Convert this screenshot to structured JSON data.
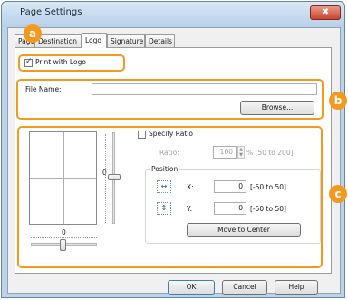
{
  "window": {
    "title": "Page Settings",
    "close_label": "✖"
  },
  "tabs": [
    {
      "label": "Page Setup",
      "active": false
    },
    {
      "label": "Destination",
      "active": false
    },
    {
      "label": "Logo",
      "active": true
    },
    {
      "label": "Signature",
      "active": false
    },
    {
      "label": "Details",
      "active": false
    }
  ],
  "callouts": {
    "a": "a",
    "b": "b",
    "c": "c"
  },
  "logo": {
    "print_with_logo_label": "Print with Logo",
    "print_with_logo_checked": true
  },
  "file": {
    "name_label": "File Name:",
    "name_value": "",
    "browse_label": "Browse..."
  },
  "preview": {
    "vertical_value": "0",
    "horizontal_value": "0"
  },
  "ratio": {
    "specify_label": "Specify Ratio",
    "specify_checked": false,
    "ratio_label": "Ratio:",
    "ratio_value": "100",
    "ratio_range": "% [50 to 200]"
  },
  "position": {
    "group_label": "Position",
    "x_label": "X:",
    "x_value": "0",
    "x_range": "[-50 to 50]",
    "y_label": "Y:",
    "y_value": "0",
    "y_range": "[-50 to 50]",
    "move_to_center_label": "Move to Center"
  },
  "footer": {
    "ok_label": "OK",
    "cancel_label": "Cancel",
    "help_label": "Help"
  },
  "colors": {
    "callout": "#f39a1e",
    "window_frame": "#bcd3ea",
    "close_button": "#c9442e"
  },
  "icons": [
    "close-icon",
    "checkbox-check-icon",
    "horizontal-position-icon",
    "vertical-position-icon",
    "spin-up-icon",
    "spin-down-icon"
  ]
}
